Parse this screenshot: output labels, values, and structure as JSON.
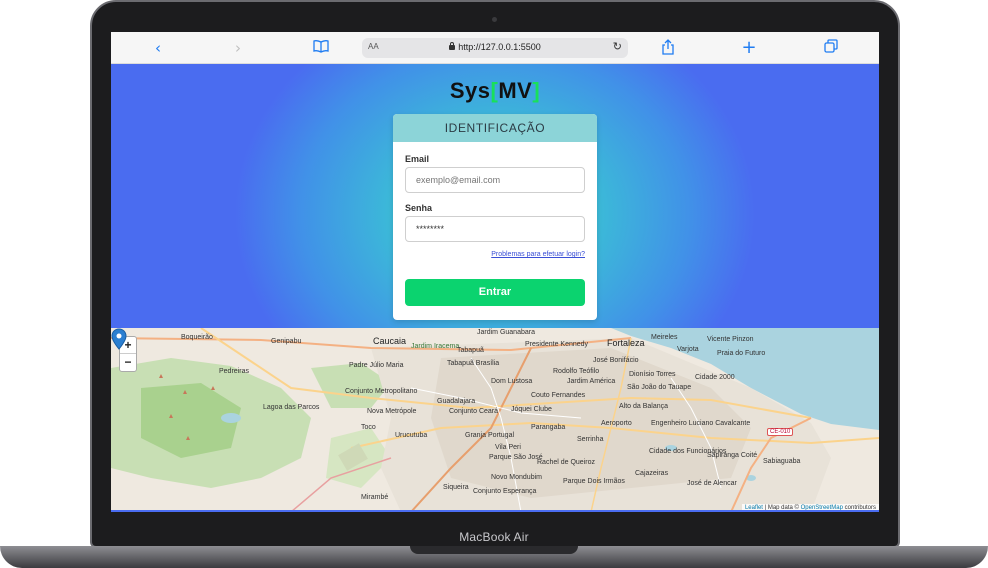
{
  "device": {
    "label": "MacBook Air"
  },
  "browser": {
    "icons": [
      "back-icon",
      "forward-icon",
      "bookmarks-icon",
      "share-icon",
      "new-tab-icon",
      "tabs-icon"
    ],
    "text_size_label": "AA",
    "url": "http://127.0.0.1:5500"
  },
  "app": {
    "logo_prefix": "Sys",
    "logo_open": "[",
    "logo_mid": "MV",
    "logo_close": "]",
    "accent_color": "#19e05a"
  },
  "login": {
    "header": "IDENTIFICAÇÃO",
    "email_label": "Email",
    "email_placeholder": "exemplo@email.com",
    "password_label": "Senha",
    "password_value": "********",
    "forgot_link": "Problemas para efetuar login?",
    "submit_label": "Entrar",
    "submit_color": "#0bd36f"
  },
  "map": {
    "zoom_in": "+",
    "zoom_out": "−",
    "labels": {
      "fortaleza": "Fortaleza",
      "caucaia": "Caucaia",
      "genipabu": "Genipabu",
      "jardim_guanabara": "Jardim Guanabara",
      "presidente_kennedy": "Presidente Kennedy",
      "meireles": "Meireles",
      "vicente_pinzon": "Vicente Pinzon",
      "praia_do_futuro": "Praia do Futuro",
      "tabapua": "Tabapuã",
      "padre_julio_maria": "Padre Júlio Maria",
      "tabapua_brasilia": "Tabapuã Brasília",
      "jose_bonifacio": "José Bonifácio",
      "rodolfo_teofilo": "Rodolfo Teófilo",
      "dionisio_torres": "Dionísio Torres",
      "cidade_2000": "Cidade 2000",
      "dom_lustosa": "Dom Lustosa",
      "jardim_america": "Jardim América",
      "sao_joao_do_tauape": "São João do Tauape",
      "pedreiras": "Pedreiras",
      "conjunto_metropolitano": "Conjunto Metropolitano",
      "couto_fernandes": "Couto Fernandes",
      "alto_da_balanca": "Alto da Balança",
      "lagoa_das_parcos": "Lagoa das Parcos",
      "nova_metropole": "Nova Metrópole",
      "guadalajara": "Guadalajara",
      "conjunto_ceara": "Conjunto Ceará",
      "joquei_clube": "Jóquei Clube",
      "parangaba": "Parangaba",
      "aeroporto": "Aeroporto",
      "engenheiro_luciano_cavalcante": "Engenheiro Luciano Cavalcante",
      "toco": "Toco",
      "urucutuba": "Urucutuba",
      "granja_portugal": "Granja Portugal",
      "serrinha": "Serrinha",
      "vila_peri": "Vila Peri",
      "cidade_dos_funcionarios": "Cidade dos Funcionários",
      "sapiranga_coite": "Sapiranga Coité",
      "sabiaguaba": "Sabiaguaba",
      "parque_sao_jose": "Parque São José",
      "rachel_de_queiroz": "Rachel de Queiroz",
      "novo_mondubim": "Novo Mondubim",
      "cajazeiras": "Cajazeiras",
      "jose_de_alencar": "José de Alencar",
      "parque_dois_irmaos": "Parque Dois Irmãos",
      "siqueira": "Siqueira",
      "conjunto_esperanca": "Conjunto Esperança",
      "mirambe": "Mirambé",
      "boqueirao": "Boqueirão",
      "jardim_iracema": "Jardim Iracema",
      "varjota": "Varjota",
      "ce_010": "CE-010"
    },
    "attribution_prefix": "Leaflet",
    "attribution_mid": " | Map data © ",
    "attribution_link": "OpenStreetMap",
    "attribution_suffix": " contributors"
  }
}
